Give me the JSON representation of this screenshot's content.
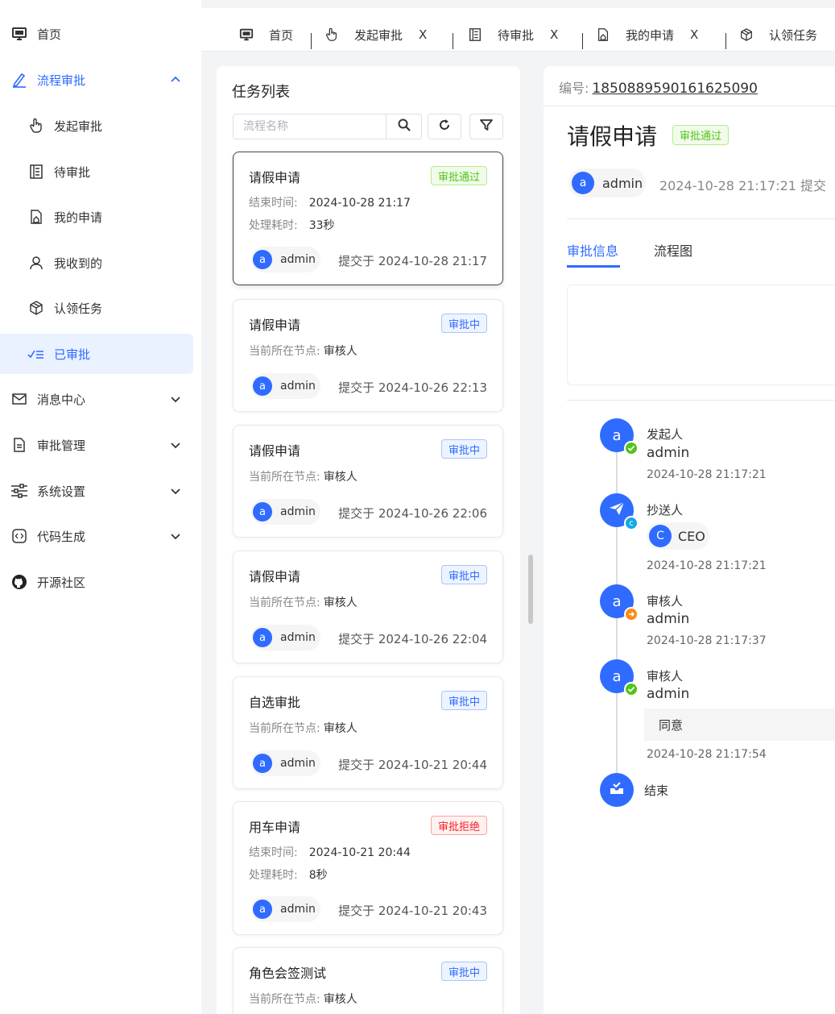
{
  "sidebar": {
    "items": [
      {
        "label": "首页",
        "icon": "monitor-icon"
      },
      {
        "label": "流程审批",
        "icon": "pen-icon"
      },
      {
        "label": "发起审批",
        "icon": "hand-pointer-icon"
      },
      {
        "label": "待审批",
        "icon": "list-doc-icon"
      },
      {
        "label": "我的申请",
        "icon": "doc-home-icon"
      },
      {
        "label": "我收到的",
        "icon": "user-icon"
      },
      {
        "label": "认领任务",
        "icon": "cube-icon"
      },
      {
        "label": "已审批",
        "icon": "check-list-icon"
      },
      {
        "label": "消息中心",
        "icon": "mail-icon"
      },
      {
        "label": "审批管理",
        "icon": "document-icon"
      },
      {
        "label": "系统设置",
        "icon": "sliders-icon"
      },
      {
        "label": "代码生成",
        "icon": "code-icon"
      },
      {
        "label": "开源社区",
        "icon": "github-icon"
      }
    ]
  },
  "tabs": [
    {
      "label": "首页",
      "icon": "monitor-icon"
    },
    {
      "label": "发起审批",
      "icon": "hand-pointer-icon",
      "close": "X"
    },
    {
      "label": "待审批",
      "icon": "list-doc-icon",
      "close": "X"
    },
    {
      "label": "我的申请",
      "icon": "doc-home-icon",
      "close": "X"
    },
    {
      "label": "认领任务",
      "icon": "cube-icon"
    }
  ],
  "task_list": {
    "title": "任务列表",
    "search_placeholder": "流程名称",
    "labels": {
      "end_time": "结束时间:",
      "duration": "处理耗时:",
      "current_node": "当前所在节点:"
    },
    "cards": [
      {
        "title": "请假申请",
        "status": "审批通过",
        "status_type": "pass",
        "end_time": "2024-10-28 21:17",
        "duration": "33秒",
        "user_initial": "a",
        "user": "admin",
        "submitted": "提交于 2024-10-28 21:17"
      },
      {
        "title": "请假申请",
        "status": "审批中",
        "status_type": "ing",
        "node": "审核人",
        "user_initial": "a",
        "user": "admin",
        "submitted": "提交于 2024-10-26 22:13"
      },
      {
        "title": "请假申请",
        "status": "审批中",
        "status_type": "ing",
        "node": "审核人",
        "user_initial": "a",
        "user": "admin",
        "submitted": "提交于 2024-10-26 22:06"
      },
      {
        "title": "请假申请",
        "status": "审批中",
        "status_type": "ing",
        "node": "审核人",
        "user_initial": "a",
        "user": "admin",
        "submitted": "提交于 2024-10-26 22:04"
      },
      {
        "title": "自选审批",
        "status": "审批中",
        "status_type": "ing",
        "node": "审核人",
        "user_initial": "a",
        "user": "admin",
        "submitted": "提交于 2024-10-21 20:44"
      },
      {
        "title": "用车申请",
        "status": "审批拒绝",
        "status_type": "reject",
        "end_time": "2024-10-21 20:44",
        "duration": "8秒",
        "user_initial": "a",
        "user": "admin",
        "submitted": "提交于 2024-10-21 20:43"
      },
      {
        "title": "角色会签测试",
        "status": "审批中",
        "status_type": "ing",
        "node": "审核人"
      }
    ]
  },
  "detail": {
    "id_label": "编号:",
    "id_value": "1850889590161625090",
    "title": "请假申请",
    "status": "审批通过",
    "user_initial": "a",
    "user": "admin",
    "submitted": "2024-10-28 21:17:21 提交",
    "tabs": [
      "审批信息",
      "流程图"
    ],
    "timeline": [
      {
        "label": "发起人",
        "initial": "a",
        "name": "admin",
        "time": "2024-10-28 21:17:21",
        "status": "done"
      },
      {
        "label": "抄送人",
        "cc_initial": "C",
        "cc_name": "CEO",
        "time": "2024-10-28 21:17:21",
        "status": "cc"
      },
      {
        "label": "审核人",
        "initial": "a",
        "name": "admin",
        "time": "2024-10-28 21:17:37",
        "status": "transfer"
      },
      {
        "label": "审核人",
        "initial": "a",
        "name": "admin",
        "comment": "同意",
        "time": "2024-10-28 21:17:54",
        "status": "done"
      },
      {
        "label": "结束",
        "status": "end"
      }
    ]
  },
  "colors": {
    "primary": "#2f6bff",
    "success": "#52c41a",
    "danger": "#f5222d",
    "warning": "#fa8c16",
    "cc": "#13a8e6"
  }
}
